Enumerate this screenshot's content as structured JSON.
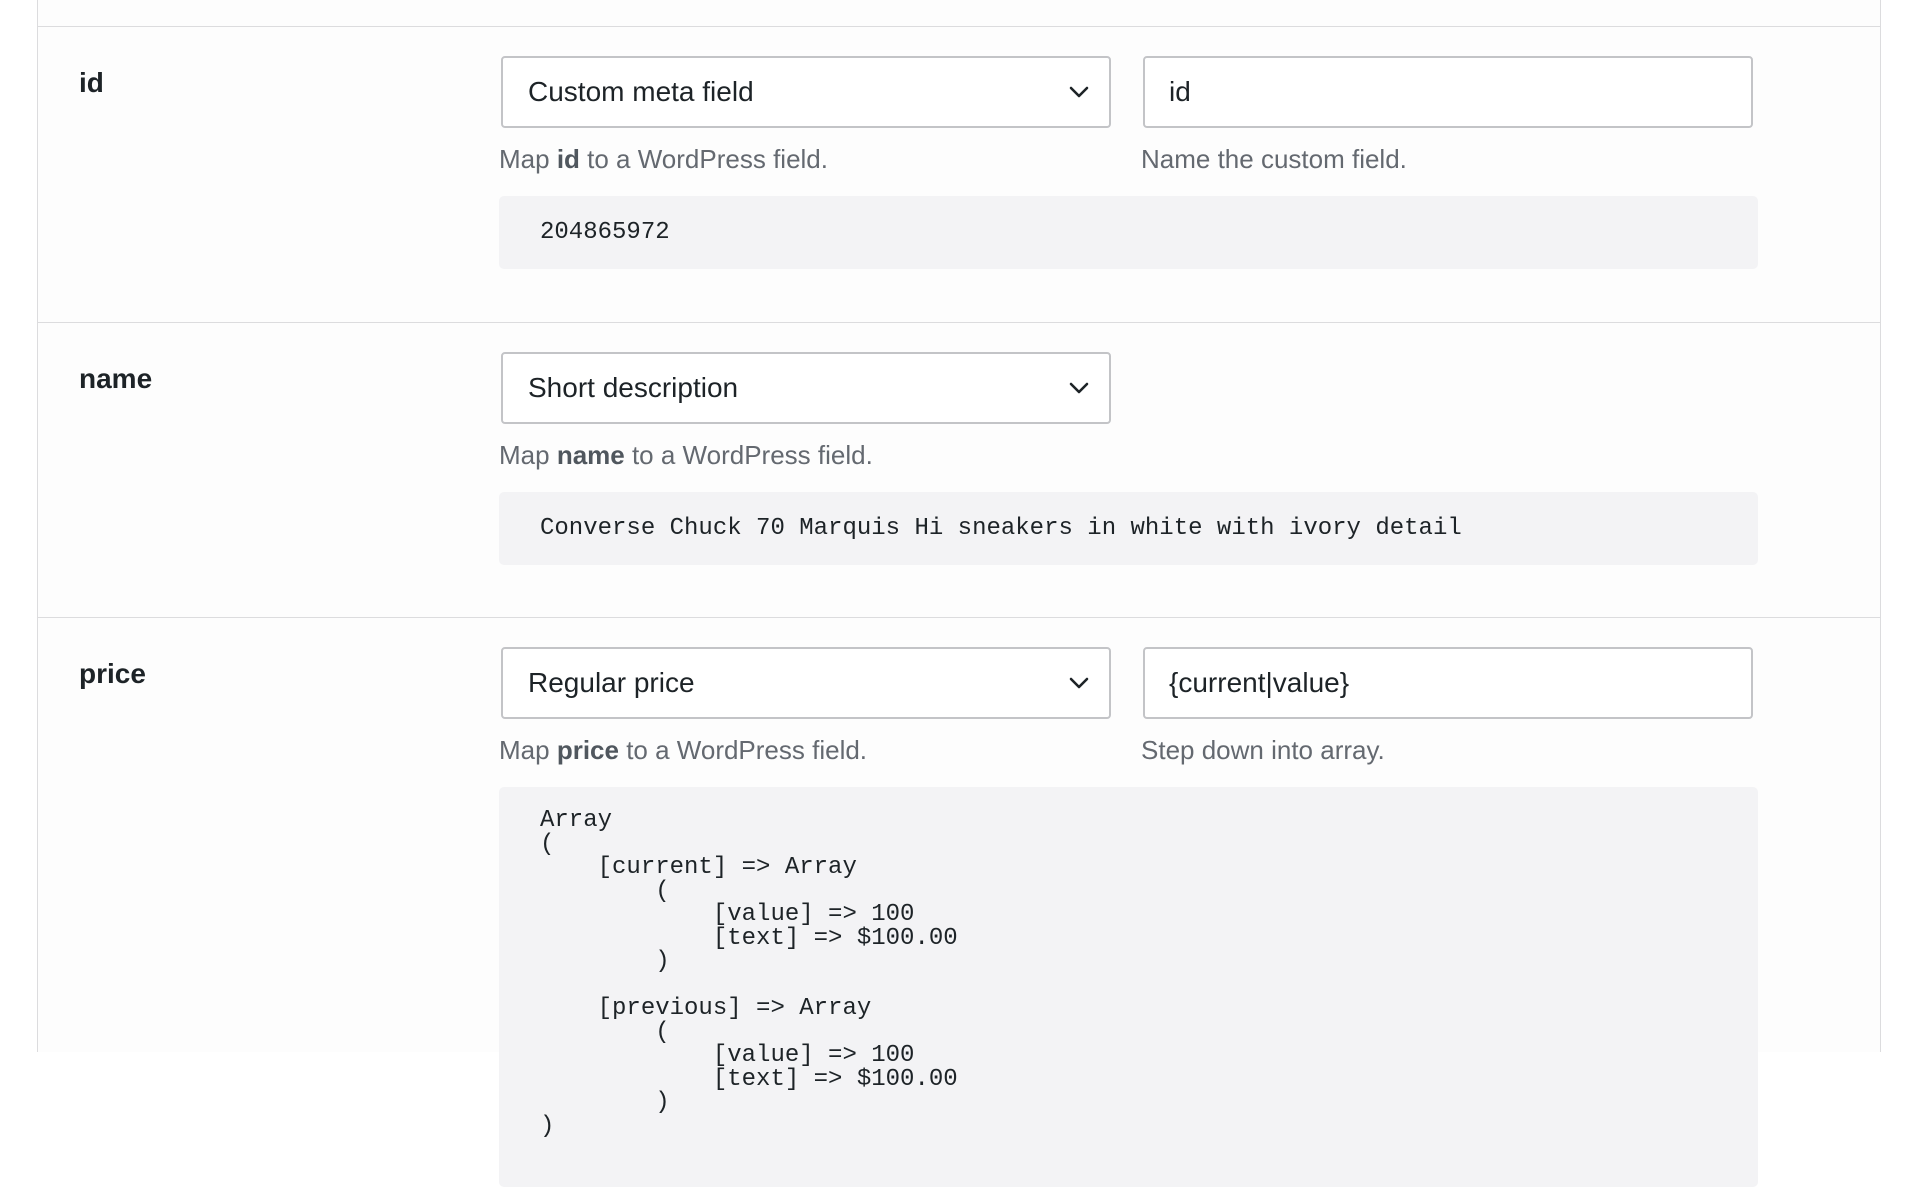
{
  "rows": [
    {
      "label": "id",
      "select_value": "Custom meta field",
      "help_prefix": "Map ",
      "help_field": "id",
      "help_suffix": " to a WordPress field.",
      "input_value": "id",
      "input_help": "Name the custom field.",
      "preview": "204865972"
    },
    {
      "label": "name",
      "select_value": "Short description",
      "help_prefix": "Map ",
      "help_field": "name",
      "help_suffix": " to a WordPress field.",
      "preview": "Converse Chuck 70 Marquis Hi sneakers in white with ivory detail"
    },
    {
      "label": "price",
      "select_value": "Regular price",
      "help_prefix": "Map ",
      "help_field": "price",
      "help_suffix": " to a WordPress field.",
      "input_value": "{current|value}",
      "input_help": "Step down into array.",
      "preview": "Array\n(\n    [current] => Array\n        (\n            [value] => 100\n            [text] => $100.00\n        )\n\n    [previous] => Array\n        (\n            [value] => 100\n            [text] => $100.00\n        )\n)"
    }
  ],
  "icons": {
    "select_chevron": "chevron-down-icon"
  }
}
